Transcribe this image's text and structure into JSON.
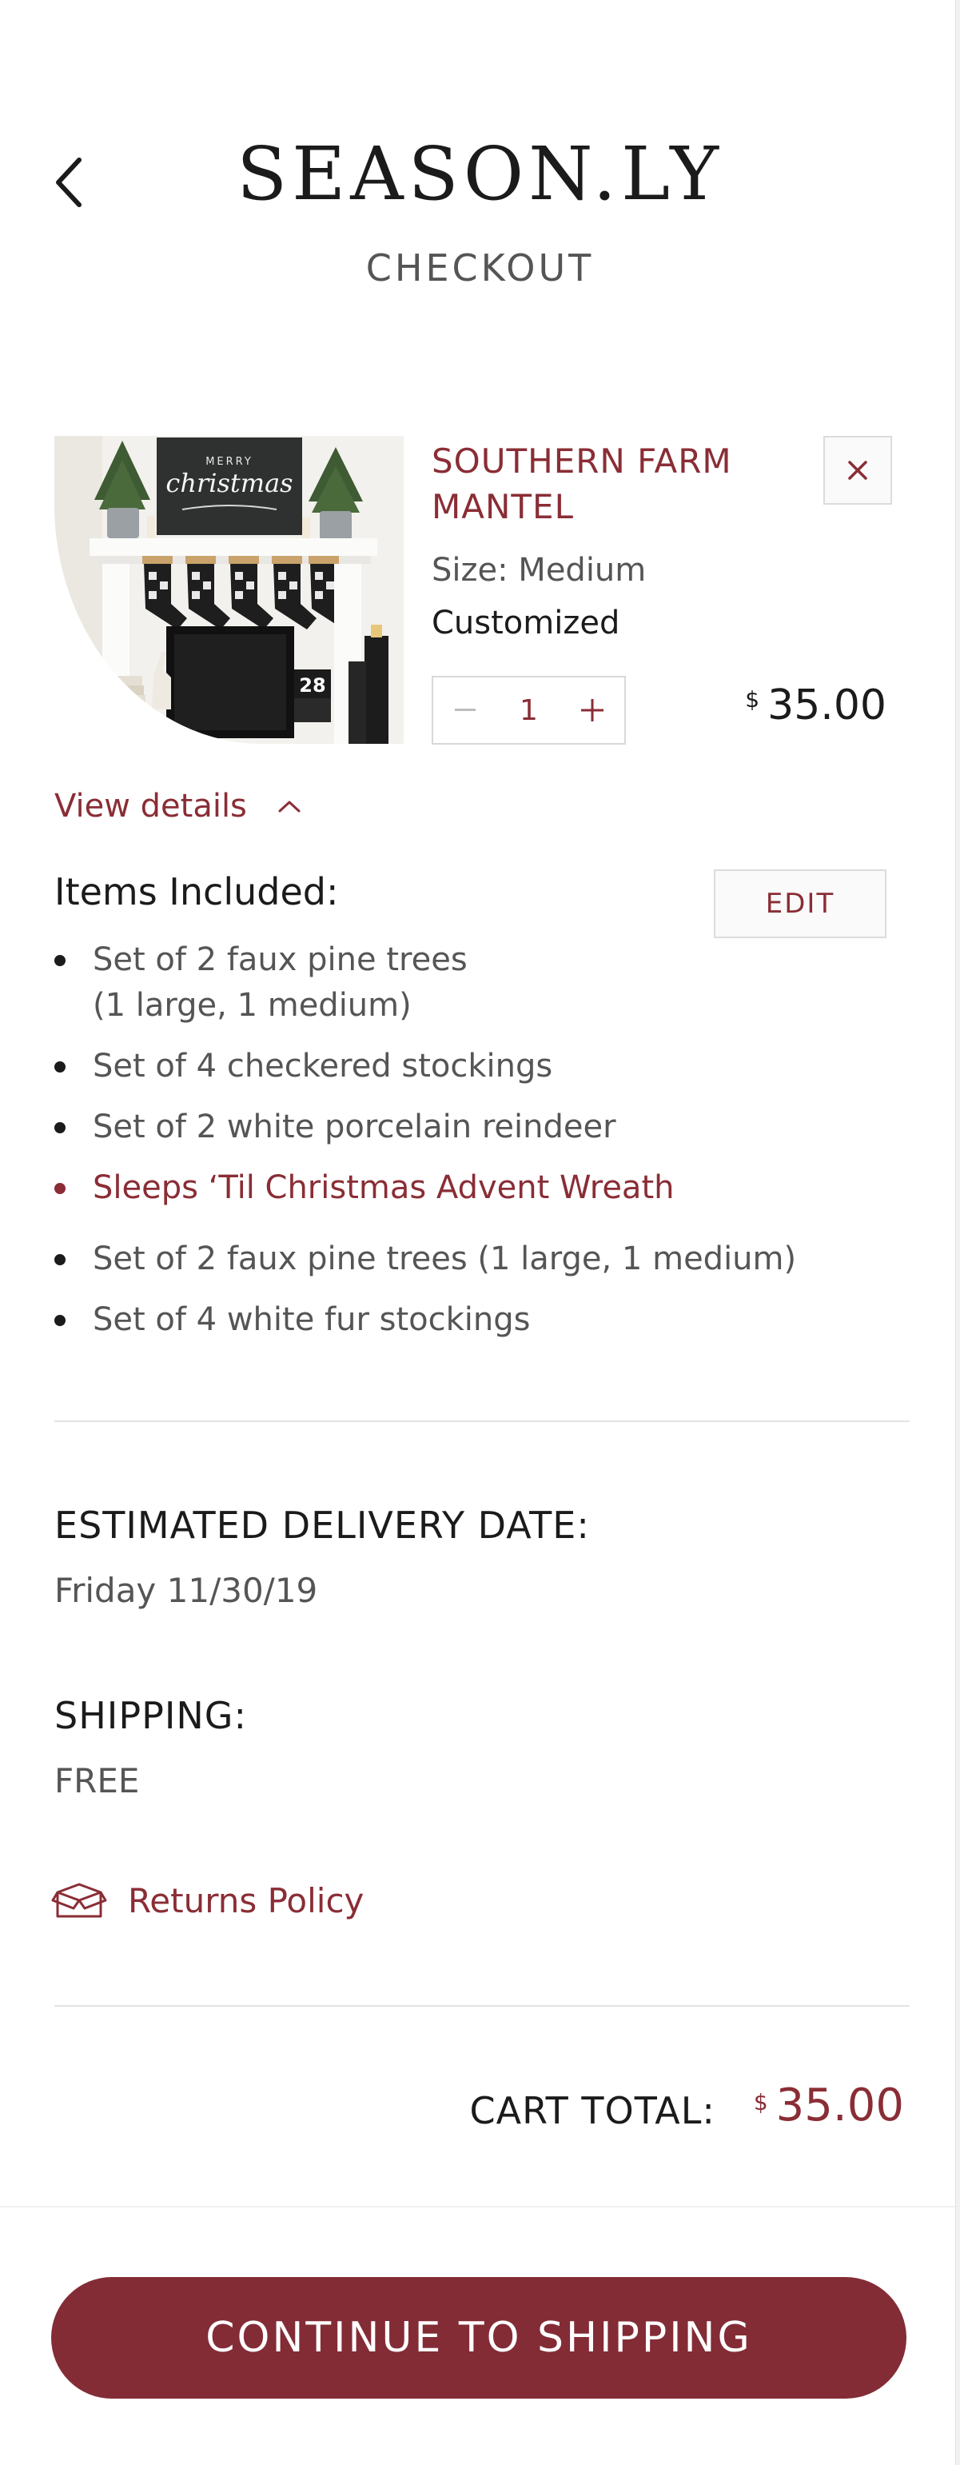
{
  "header": {
    "brand": "SEASON.LY",
    "subtitle": "CHECKOUT"
  },
  "product": {
    "image_text_top": "MERRY",
    "image_text_script": "christmas",
    "image_calendar": "28",
    "title": "SOUTHERN FARM MANTEL",
    "size": "Size: Medium",
    "customized": "Customized",
    "quantity": "1",
    "currency": "$",
    "price": "35.00"
  },
  "details": {
    "toggle_label": "View details",
    "items_title": "Items Included:",
    "edit_label": "EDIT",
    "items": [
      {
        "text": "Set of 2 faux pine trees\n(1 large, 1 medium)"
      },
      {
        "text": "Set of 4 checkered stockings"
      },
      {
        "text": "Set of 2 white porcelain reindeer"
      },
      {
        "text": "Sleeps ‘Til Christmas Advent Wreath"
      },
      {
        "text": "Set of 2 faux pine trees (1 large, 1 medium)"
      },
      {
        "text": "Set of 4 white fur stockings"
      }
    ]
  },
  "delivery": {
    "label": "ESTIMATED DELIVERY DATE:",
    "value": "Friday 11/30/19"
  },
  "shipping": {
    "label": "SHIPPING:",
    "value": "FREE"
  },
  "returns": {
    "label": "Returns Policy"
  },
  "total": {
    "label": "CART TOTAL:",
    "currency": "$",
    "value": "35.00"
  },
  "cta": {
    "label": "CONTINUE TO SHIPPING"
  },
  "colors": {
    "accent": "#832c35",
    "accent_text": "#8a2d35",
    "muted_text": "#555555"
  },
  "icons": {
    "back": "chevron-left-icon",
    "remove": "close-icon",
    "toggle": "chevron-up-icon",
    "returns": "open-box-icon"
  }
}
